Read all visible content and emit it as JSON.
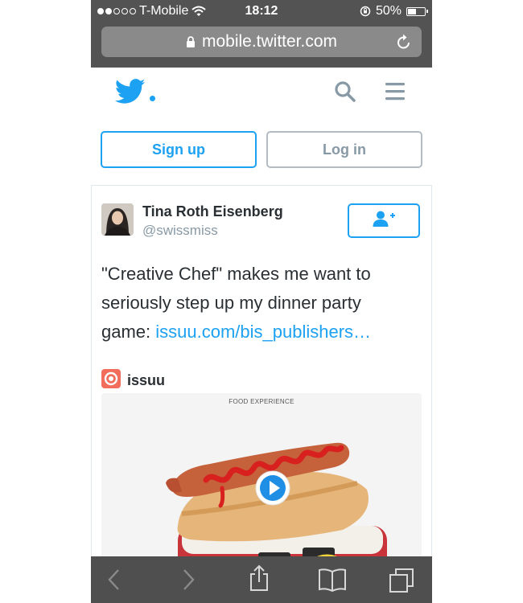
{
  "status_bar": {
    "carrier": "T-Mobile",
    "time": "18:12",
    "battery": "50%",
    "battery_level": 0.5,
    "signal_bars": 2
  },
  "browser": {
    "url": "mobile.twitter.com",
    "icons": [
      "lock-icon",
      "reload-icon",
      "back-icon",
      "forward-icon",
      "share-icon",
      "bookmarks-icon",
      "tabs-icon"
    ]
  },
  "header": {
    "icons": [
      "twitter-bird-icon",
      "search-icon",
      "menu-icon"
    ]
  },
  "auth": {
    "signup_label": "Sign up",
    "login_label": "Log in"
  },
  "tweet": {
    "author_name": "Tina Roth Eisenberg",
    "author_handle": "@swissmiss",
    "text_line1": "\"Creative Chef\" makes me want to",
    "text_line2": "seriously step up my dinner party",
    "text_line3_prefix": "game: ",
    "link_text": "issuu.com/bis_publishers…",
    "source_name": "issuu",
    "media_caption": "FOOD EXPERIENCE"
  },
  "colors": {
    "twitter_blue": "#1da1f2",
    "safari_chrome": "#535353",
    "issuu_orange": "#f36d5d"
  }
}
